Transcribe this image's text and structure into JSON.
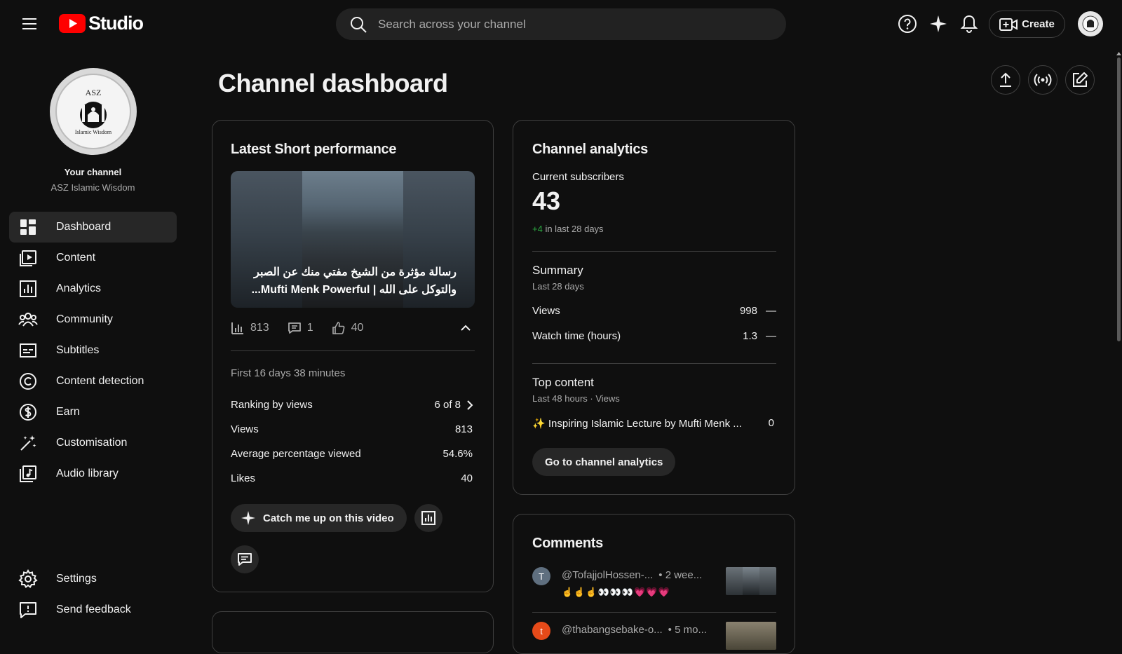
{
  "app": {
    "logo_text": "Studio",
    "brand_color": "#ff0000",
    "search_placeholder": "Search across your channel",
    "create_label": "Create"
  },
  "sidebar": {
    "avatar_text_top": "ASZ",
    "avatar_text_bottom": "Islamic Wisdom",
    "your_channel_label": "Your channel",
    "channel_name": "ASZ Islamic Wisdom",
    "items": [
      {
        "label": "Dashboard",
        "icon": "dashboard-icon",
        "active": true
      },
      {
        "label": "Content",
        "icon": "content-icon"
      },
      {
        "label": "Analytics",
        "icon": "analytics-icon"
      },
      {
        "label": "Community",
        "icon": "community-icon"
      },
      {
        "label": "Subtitles",
        "icon": "subtitles-icon"
      },
      {
        "label": "Content detection",
        "icon": "copyright-icon"
      },
      {
        "label": "Earn",
        "icon": "dollar-icon"
      },
      {
        "label": "Customisation",
        "icon": "magic-wand-icon"
      },
      {
        "label": "Audio library",
        "icon": "audio-library-icon"
      }
    ],
    "bottom_items": [
      {
        "label": "Settings",
        "icon": "gear-icon"
      },
      {
        "label": "Send feedback",
        "icon": "feedback-icon"
      }
    ]
  },
  "main": {
    "title": "Channel dashboard",
    "latest_short": {
      "title": "Latest Short performance",
      "video_title": "رسالة مؤثرة من الشيخ مفتي منك عن الصبر والتوكل على الله | Mufti Menk Powerful...",
      "views_stat": "813",
      "comments_stat": "1",
      "likes_stat": "40",
      "period": "First 16 days 38 minutes",
      "rows": [
        {
          "label": "Ranking by views",
          "value": "6 of 8"
        },
        {
          "label": "Views",
          "value": "813"
        },
        {
          "label": "Average percentage viewed",
          "value": "54.6%"
        },
        {
          "label": "Likes",
          "value": "40"
        }
      ],
      "catch_up_label": "Catch me up on this video"
    },
    "channel_analytics": {
      "title": "Channel analytics",
      "subscribers_label": "Current subscribers",
      "subscribers_count": "43",
      "subscribers_change": "+4",
      "subscribers_change_suffix": "in last 28 days",
      "positive_color": "#2ba640",
      "summary_title": "Summary",
      "summary_period": "Last 28 days",
      "summary_rows": [
        {
          "label": "Views",
          "value": "998",
          "trend": "—"
        },
        {
          "label": "Watch time (hours)",
          "value": "1.3",
          "trend": "—"
        }
      ],
      "top_content_title": "Top content",
      "top_content_period": "Last 48 hours · Views",
      "top_content_item": "✨ Inspiring Islamic Lecture by Mufti Menk ...",
      "top_content_value": "0",
      "go_button": "Go to channel analytics"
    },
    "comments": {
      "title": "Comments",
      "items": [
        {
          "avatar_letter": "T",
          "avatar_color": "#5f6f7f",
          "author": "@TofajjolHossen-...",
          "time": "• 2 wee...",
          "text": "☝️☝️☝️👀👀👀💗💗💗"
        },
        {
          "avatar_letter": "t",
          "avatar_color": "#e64a19",
          "author": "@thabangsebake-o...",
          "time": "• 5 mo..."
        }
      ]
    }
  }
}
